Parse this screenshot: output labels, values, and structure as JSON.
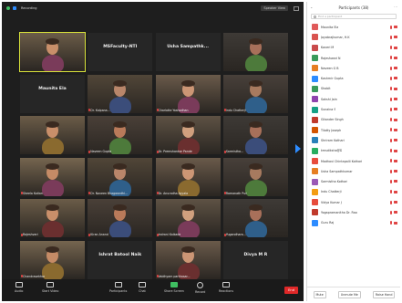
{
  "meeting": {
    "recording_label": "Recording",
    "view_label": "Speaker View",
    "colors": {
      "bg": "#1e1e1e",
      "active_border": "#d8e23a",
      "end": "#e02828",
      "accent": "#2d8cff"
    }
  },
  "tiles": [
    {
      "name": "",
      "center": "",
      "video": true,
      "active": true
    },
    {
      "name": "",
      "center": "MSFaculty-NTI",
      "video": false
    },
    {
      "name": "",
      "center": "Usha Sampathk...",
      "video": false
    },
    {
      "name": "",
      "center": "",
      "video": true
    },
    {
      "name": "",
      "center": "Maunita Ela",
      "video": false
    },
    {
      "name": "Dr. Kalpana...",
      "center": "",
      "video": true
    },
    {
      "name": "Charlotte Yashodhan",
      "center": "",
      "video": true
    },
    {
      "name": "Indu Chatterji",
      "center": "",
      "video": true
    },
    {
      "name": "",
      "center": "",
      "video": true
    },
    {
      "name": "Naveen Gupta",
      "center": "",
      "video": true
    },
    {
      "name": "Dr. Premshankar Pande",
      "center": "",
      "video": true
    },
    {
      "name": "Sarmistha...",
      "center": "",
      "video": true
    },
    {
      "name": "Sheela Kotian",
      "center": "",
      "video": true
    },
    {
      "name": "Dr. Naveen Bhagwanthi...",
      "center": "",
      "video": true
    },
    {
      "name": "Dr. Anuradha Ayyala",
      "center": "",
      "video": true
    },
    {
      "name": "Ramanath Puri",
      "center": "",
      "video": true
    },
    {
      "name": "Rajeshvari",
      "center": "",
      "video": true
    },
    {
      "name": "Kiran Anand",
      "center": "",
      "video": true
    },
    {
      "name": "Indrani Kaikade",
      "center": "",
      "video": true
    },
    {
      "name": "Yugandhara...",
      "center": "",
      "video": true
    },
    {
      "name": "Chandrasekhar",
      "center": "",
      "video": true
    },
    {
      "name": "",
      "center": "Ishrat Batool Naik",
      "video": false
    },
    {
      "name": "Vaidhyam parthasar...",
      "center": "",
      "video": true
    },
    {
      "name": "",
      "center": "Divya M R",
      "video": false
    }
  ],
  "toolbar": {
    "items": [
      {
        "label": "Audio",
        "icon": "microphone-icon"
      },
      {
        "label": "Start Video",
        "icon": "video-camera-icon"
      },
      {
        "label": "Participants",
        "icon": "participants-icon"
      },
      {
        "label": "Chat",
        "icon": "chat-icon"
      },
      {
        "label": "Share Screen",
        "icon": "share-screen-icon"
      },
      {
        "label": "Record",
        "icon": "record-icon"
      },
      {
        "label": "Reactions",
        "icon": "reactions-icon"
      }
    ],
    "end_label": "End"
  },
  "panel": {
    "title": "Participants (38)",
    "search_placeholder": "Find a participant",
    "participants": [
      {
        "name": "Maunita Ela",
        "color": "#e05a5a"
      },
      {
        "name": "Jayabrajkumar, H.K",
        "color": "#d9534f"
      },
      {
        "name": "Kaveri M",
        "color": "#c94b4b"
      },
      {
        "name": "Rajeshwari N",
        "color": "#3a9a5b"
      },
      {
        "name": "Naveen G B",
        "color": "#e67e22"
      },
      {
        "name": "Kashmir Gupta",
        "color": "#2d8cff"
      },
      {
        "name": "Shobit",
        "color": "#3a9a5b"
      },
      {
        "name": "Sakshi Jain",
        "color": "#8e44ad"
      },
      {
        "name": "Sunaina S",
        "color": "#16a085"
      },
      {
        "name": "Gitander Singh",
        "color": "#c0392b"
      },
      {
        "name": "Tilotty Joseph",
        "color": "#d35400"
      },
      {
        "name": "Shriram Kothari",
        "color": "#2980b9"
      },
      {
        "name": "kmsdiksha@D",
        "color": "#27ae60"
      },
      {
        "name": "Madhavi Chintapalli Kothari",
        "color": "#e74c3c"
      },
      {
        "name": "Usha Sampathkumar",
        "color": "#e67e22"
      },
      {
        "name": "Sarmistha Kothari",
        "color": "#9b59b6"
      },
      {
        "name": "Indu Chatterji",
        "color": "#f39c12"
      },
      {
        "name": "Vidya Kumar J",
        "color": "#e74c3c"
      },
      {
        "name": "Yogapramanitha Dr. Rao",
        "color": "#c0392b"
      },
      {
        "name": "Guru Raj",
        "color": "#2d8cff"
      }
    ],
    "footer": {
      "mute_all": "Mute",
      "unmute_all": "Unmute Me",
      "raise_hand": "Raise Hand"
    }
  }
}
